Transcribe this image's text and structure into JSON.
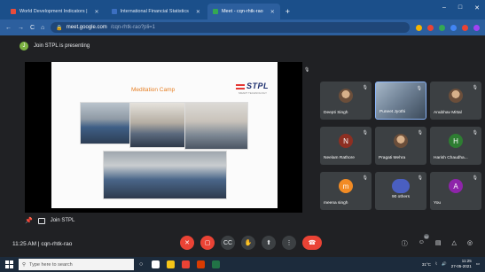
{
  "browser": {
    "tabs": [
      {
        "label": "World Development Indicators |",
        "favicon_color": "#e74c3c",
        "active": false
      },
      {
        "label": "International Financial Statistics",
        "favicon_color": "#3b6fc1",
        "active": false
      },
      {
        "label": "Meet - cqn-rhtk-rao",
        "favicon_color": "#34a853",
        "active": true
      }
    ],
    "new_tab": "+",
    "window_controls": [
      "–",
      "□",
      "✕"
    ],
    "nav": [
      "←",
      "→",
      "C",
      "⌂"
    ],
    "url_host": "meet.google.com",
    "url_path": "/cqn-rhtk-rao?pli=1",
    "extension_colors": [
      "#f5b400",
      "#ea4335",
      "#34a853",
      "#4285f4",
      "#ea4335",
      "#a142f4"
    ]
  },
  "banner": {
    "avatar_letter": "J",
    "text": "Join STPL is presenting"
  },
  "slide": {
    "title": "Meditation Camp",
    "logo": "STPL",
    "logo_sub": "SMART TECHNOLOGY"
  },
  "stage_footer": {
    "presenter": "Join STPL"
  },
  "participants": [
    {
      "name": "Deepti Singh",
      "type": "photo",
      "color": "#6b4e3a"
    },
    {
      "name": "Puneet Jyothi",
      "type": "video",
      "color": "#8ab4f8"
    },
    {
      "name": "Anubhav Mittal",
      "type": "photo",
      "color": "#6b4e3a"
    },
    {
      "name": "Neelam Rathore",
      "type": "letter",
      "letter": "N",
      "color": "#8d2f22"
    },
    {
      "name": "Pragati Mehra",
      "type": "photo",
      "color": "#6b4e3a"
    },
    {
      "name": "Harish Chaudha...",
      "type": "letter",
      "letter": "H",
      "color": "#2e7d32"
    },
    {
      "name": "meena singh",
      "type": "letter",
      "letter": "m",
      "color": "#f28b24"
    },
    {
      "name": "90 others",
      "type": "group",
      "color": "#4a5fc1"
    },
    {
      "name": "You",
      "type": "letter",
      "letter": "A",
      "color": "#8e24aa"
    }
  ],
  "meeting": {
    "time": "11:25 AM",
    "separator": "|",
    "code": "cqn-rhtk-rao",
    "controls": [
      {
        "name": "mic-off-button",
        "glyph": "✕",
        "red": true
      },
      {
        "name": "camera-off-button",
        "glyph": "▢",
        "red": true
      },
      {
        "name": "captions-button",
        "glyph": "CC",
        "red": false
      },
      {
        "name": "raise-hand-button",
        "glyph": "✋",
        "red": false
      },
      {
        "name": "present-button",
        "glyph": "⬆",
        "red": false
      },
      {
        "name": "more-options-button",
        "glyph": "⋮",
        "red": false
      }
    ],
    "end_glyph": "☎",
    "right_controls": [
      {
        "name": "info-icon",
        "glyph": "ⓘ"
      },
      {
        "name": "people-icon",
        "glyph": "☺",
        "badge": "92"
      },
      {
        "name": "chat-icon",
        "glyph": "▤"
      },
      {
        "name": "activities-icon",
        "glyph": "△"
      },
      {
        "name": "host-controls-icon",
        "glyph": "◎"
      }
    ]
  },
  "taskbar": {
    "search_placeholder": "Type here to search",
    "app_colors": [
      "#ffffff",
      "#f5c518",
      "#ea4335",
      "#d83b01",
      "#217346"
    ],
    "temperature": "31°C",
    "time": "11:25",
    "date": "27-05-2021"
  }
}
